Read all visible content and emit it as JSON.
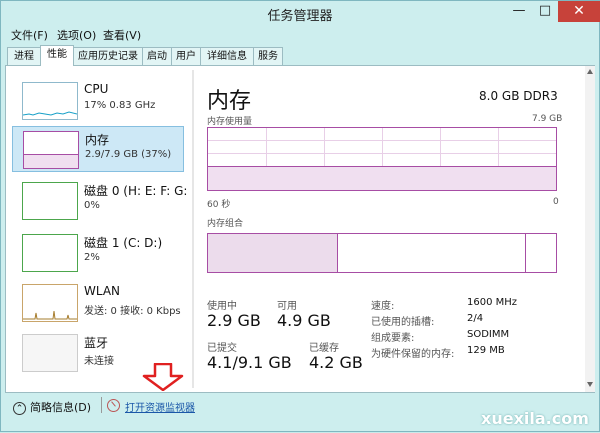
{
  "window": {
    "title": "任务管理器",
    "min": "—",
    "max": "□",
    "close": "✕"
  },
  "menu": [
    "文件(F)",
    "选项(O)",
    "查看(V)"
  ],
  "tabs": [
    {
      "label": "进程",
      "active": false
    },
    {
      "label": "性能",
      "active": true
    },
    {
      "label": "应用历史记录",
      "active": false
    },
    {
      "label": "启动",
      "active": false
    },
    {
      "label": "用户",
      "active": false
    },
    {
      "label": "详细信息",
      "active": false
    },
    {
      "label": "服务",
      "active": false
    }
  ],
  "sidebar": [
    {
      "name": "CPU",
      "value": "17% 0.83 GHz",
      "selected": false,
      "color": "#17a0c8"
    },
    {
      "name": "内存",
      "value": "2.9/7.9 GB (37%)",
      "selected": true,
      "color": "#a74da4"
    },
    {
      "name": "磁盘 0 (H: E: F: G:",
      "value": "0%",
      "selected": false,
      "color": "#4ca64c"
    },
    {
      "name": "磁盘 1 (C: D:)",
      "value": "2%",
      "selected": false,
      "color": "#4ca64c"
    },
    {
      "name": "WLAN",
      "value": "发送: 0 接收: 0 Kbps",
      "selected": false,
      "color": "#a67c2c"
    },
    {
      "name": "蓝牙",
      "value": "未连接",
      "selected": false,
      "color": "#cccccc"
    }
  ],
  "memory": {
    "title": "内存",
    "spec": "8.0 GB DDR3",
    "usage_label": "内存使用量",
    "usage_max": "7.9 GB",
    "time_left": "60 秒",
    "time_right": "0",
    "usage_fraction": 0.37,
    "composition_label": "内存组合",
    "composition_inuse_fraction": 0.37,
    "composition_standby_fraction": 0.54,
    "in_use_label": "使用中",
    "in_use_value": "2.9 GB",
    "available_label": "可用",
    "available_value": "4.9 GB",
    "committed_label": "已提交",
    "committed_value": "4.1/9.1 GB",
    "cached_label": "已缓存",
    "cached_value": "4.2 GB",
    "details": [
      {
        "k": "速度:",
        "v": "1600 MHz"
      },
      {
        "k": "已使用的插槽:",
        "v": "2/4"
      },
      {
        "k": "组成要素:",
        "v": "SODIMM"
      },
      {
        "k": "为硬件保留的内存:",
        "v": "129 MB"
      }
    ]
  },
  "footer": {
    "fewer_details": "简略信息(D)",
    "resource_monitor": "打开资源监视器"
  },
  "watermark": "xuexila.com"
}
